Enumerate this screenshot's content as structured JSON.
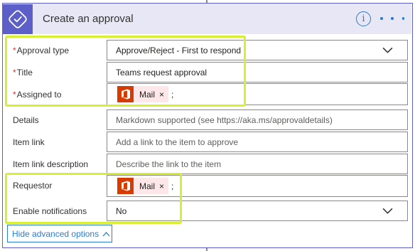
{
  "card": {
    "title": "Create an approval",
    "header_icon": "approval-check-icon",
    "info_label": "i",
    "accent_color": "#5b5fc7",
    "link_color": "#2b7cd3",
    "highlight_color": "#d6ef35"
  },
  "fields": {
    "approval_type": {
      "required_mark": "*",
      "label": "Approval type",
      "value": "Approve/Reject - First to respond"
    },
    "title": {
      "required_mark": "*",
      "label": "Title",
      "value": "Teams request approval"
    },
    "assigned_to": {
      "required_mark": "*",
      "label": "Assigned to",
      "tag": "Mail",
      "tag_close": "×",
      "separator": ";"
    },
    "details": {
      "label": "Details",
      "placeholder": "Markdown supported (see https://aka.ms/approvaldetails)"
    },
    "item_link": {
      "label": "Item link",
      "placeholder": "Add a link to the item to approve"
    },
    "item_link_description": {
      "label": "Item link description",
      "placeholder": "Describe the link to the item"
    },
    "requestor": {
      "label": "Requestor",
      "tag": "Mail",
      "tag_close": "×",
      "separator": ";"
    },
    "enable_notifications": {
      "label": "Enable notifications",
      "value": "No"
    }
  },
  "advanced": {
    "label": "Hide advanced options"
  }
}
